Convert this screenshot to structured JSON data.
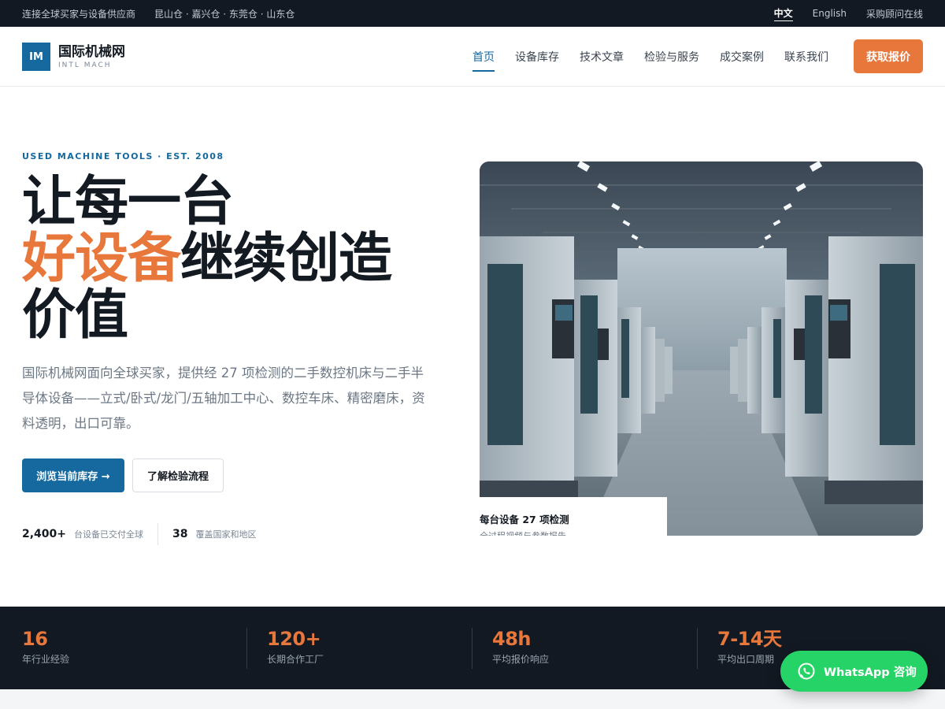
{
  "topbar": {
    "tagline": "连接全球买家与设备供应商",
    "warehouses": "昆山仓 · 嘉兴仓 · 东莞仓 · 山东仓",
    "lang_zh": "中文",
    "lang_en": "English",
    "advisor": "采购顾问在线"
  },
  "header": {
    "logo_mark": "IM",
    "logo_name": "国际机械网",
    "logo_sub": "INTL MACH",
    "nav": [
      "首页",
      "设备库存",
      "技术文章",
      "检验与服务",
      "成交案例",
      "联系我们"
    ],
    "active_nav": "首页",
    "cta": "获取报价"
  },
  "hero": {
    "eyebrow": "USED MACHINE TOOLS · EST. 2008",
    "title_line1": "让每一台",
    "title_accent": "好设备",
    "title_line2_rest": "继续创造",
    "title_line3": "价值",
    "description": "国际机械网面向全球买家，提供经 27 项检测的二手数控机床与二手半导体设备——立式/卧式/龙门/五轴加工中心、数控车床、精密磨床，资料透明，出口可靠。",
    "primary_button": "浏览当前库存 →",
    "secondary_button": "了解检验流程",
    "mini_stats": [
      {
        "value": "2,400+",
        "label": "台设备已交付全球"
      },
      {
        "value": "38",
        "label": "覆盖国家和地区"
      }
    ],
    "image_card_title": "每台设备 27 项检测",
    "image_card_sub": "全过程视频与参数报告"
  },
  "stats": [
    {
      "value": "16",
      "label": "年行业经验"
    },
    {
      "value": "120+",
      "label": "长期合作工厂"
    },
    {
      "value": "48h",
      "label": "平均报价响应"
    },
    {
      "value": "7-14天",
      "label": "平均出口周期"
    }
  ],
  "whatsapp": {
    "label": "WhatsApp 咨询"
  },
  "colors": {
    "brand_blue": "#15699f",
    "accent_orange": "#e8773c",
    "dark_navy": "#131922",
    "whatsapp_green": "#25d366"
  },
  "icons": {
    "whatsapp": "whatsapp-icon",
    "arrow": "arrow-right-icon"
  }
}
